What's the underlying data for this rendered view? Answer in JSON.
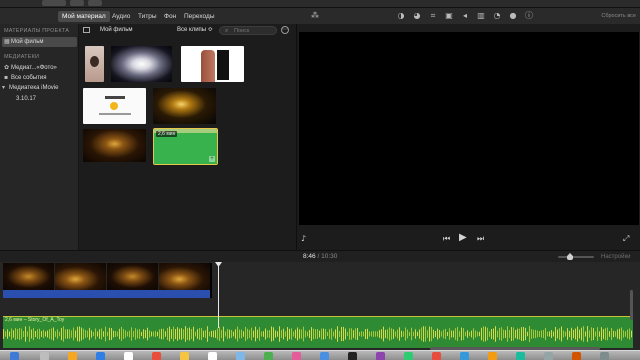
{
  "tabs": {
    "my_material": "Мой материал",
    "audio": "Аудио",
    "titles": "Титры",
    "background": "Фон",
    "transitions": "Переходы"
  },
  "viewer_toolbar": {
    "icons": [
      "magic-wand-icon",
      "color-balance-icon",
      "color-correction-icon",
      "crop-icon",
      "stabilization-icon",
      "volume-icon",
      "equalizer-icon",
      "speed-icon",
      "clip-filter-icon",
      "info-icon"
    ],
    "reset_all": "Сбросить все"
  },
  "sidebar": {
    "project_header": "МАТЕРИАЛЫ ПРОЕКТА",
    "project_item": "Мой фильм",
    "libraries_header": "МЕДИАТЕКИ",
    "library_items": [
      "Медиат...«Фото»",
      "Все события"
    ],
    "imovie_library": "Медиатека iMovie",
    "event": "3.10.17"
  },
  "browser": {
    "title": "Мой фильм",
    "filter": "Все клипы ≎",
    "search_placeholder": "Поиск",
    "selected_clip_duration": "2,6 мин"
  },
  "timeline": {
    "current_time": "8:46",
    "separator": "/",
    "total_time": "10:30",
    "settings": "Настройки",
    "audio_label": "2,6 мин – Story_Of_A_Toy"
  },
  "colors": {
    "accent_selection": "#e8c64b",
    "audio_track": "#2e8b34",
    "video_bar": "#2b4fae",
    "panel_bg": "#1c1c1c"
  }
}
